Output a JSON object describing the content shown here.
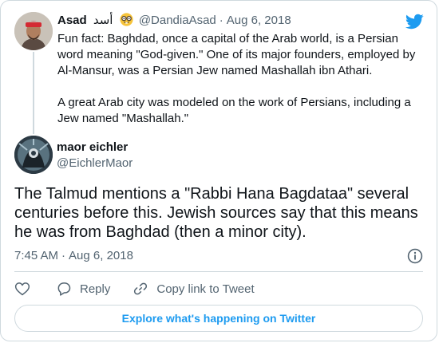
{
  "parent_tweet": {
    "author_name": "Asad",
    "author_name_arabic": "أسد",
    "author_emoji": "nerd-face-icon",
    "handle": "@DandiaAsad",
    "separator": "·",
    "date": "Aug 6, 2018",
    "paragraphs": [
      "Fun fact: Baghdad, once a capital of the Arab world, is a Persian word meaning \"God-given.\" One of its major founders, employed by Al-Mansur, was a Persian Jew named Mashallah ibn Athari.",
      "A great Arab city was modeled on the work of Persians, including a Jew named \"Mashallah.\""
    ]
  },
  "main_tweet": {
    "author_name": "maor eichler",
    "handle": "@EichlerMaor",
    "text": "The Talmud mentions a \"Rabbi Hana Bagdataa\" several centuries before this. Jewish sources say that this means he was from Baghdad (then a minor city).",
    "time": "7:45 AM",
    "separator": "·",
    "date": "Aug 6, 2018"
  },
  "actions": {
    "like_icon": "heart-icon",
    "reply_icon": "reply-icon",
    "reply_label": "Reply",
    "copy_icon": "link-icon",
    "copy_label": "Copy link to Tweet"
  },
  "explore_label": "Explore what's happening on Twitter",
  "colors": {
    "accent": "#1d9bf0",
    "text": "#0f1419",
    "muted": "#536471",
    "border": "#cfd9de"
  },
  "icons": {
    "brand": "twitter-bird-icon",
    "info": "info-icon"
  }
}
